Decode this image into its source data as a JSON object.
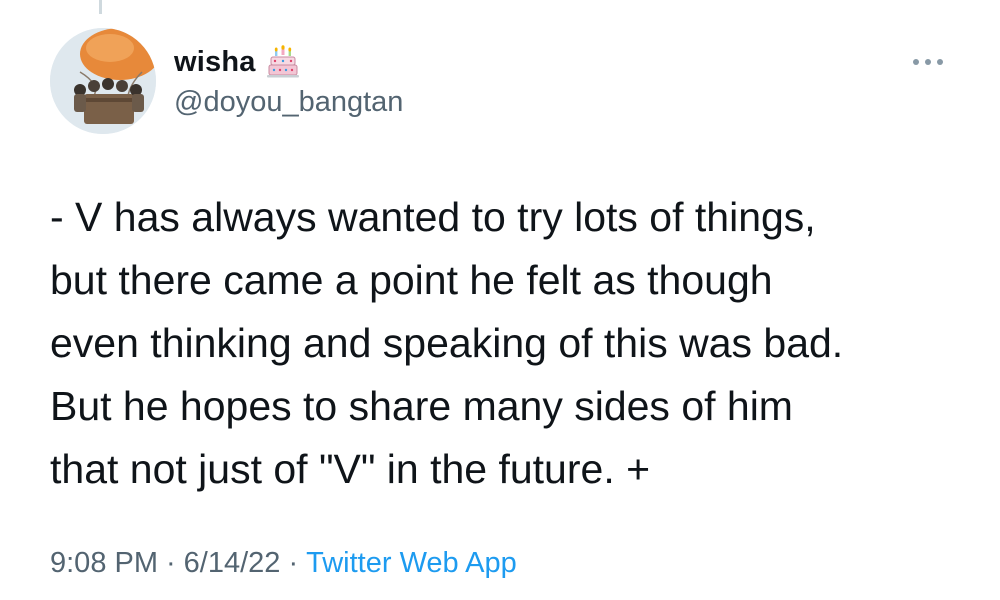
{
  "user": {
    "display_name": "wisha",
    "handle": "@doyou_bangtan",
    "avatar_icon": "hot-air-balloon-photo",
    "badge_icon": "birthday-cake-icon"
  },
  "tweet": {
    "text": "- V has always wanted to try lots of things,\nbut there came a point he felt as though\neven thinking and speaking of this was bad.\nBut he hopes to share many sides of him\nthat not just of \"V\" in the future. +",
    "time": "9:08 PM",
    "separator": "·",
    "date": "6/14/22",
    "source": "Twitter Web App"
  },
  "menu": {
    "icon": "more-icon"
  },
  "colors": {
    "text": "#0f1419",
    "secondary": "#536471",
    "link": "#1d9bf0"
  }
}
